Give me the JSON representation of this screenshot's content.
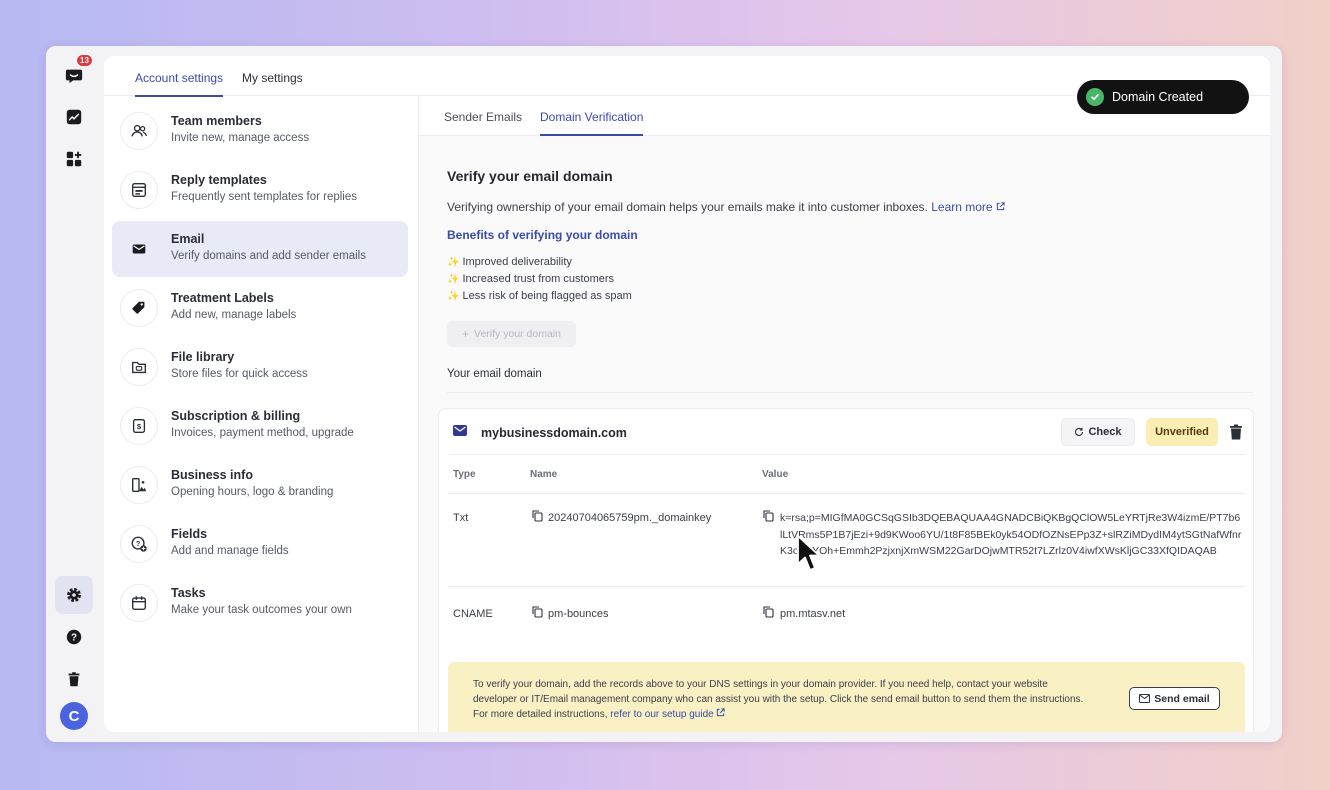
{
  "rail": {
    "notification_count": "13",
    "items": [
      {
        "icon": "chat-logo-icon"
      },
      {
        "icon": "chart-icon"
      },
      {
        "icon": "apps-icon"
      },
      {
        "icon": "gear-icon"
      },
      {
        "icon": "help-icon"
      },
      {
        "icon": "trash-icon"
      }
    ],
    "avatar_initial": "C"
  },
  "settings_tabs": [
    {
      "label": "Account settings",
      "active": true
    },
    {
      "label": "My settings",
      "active": false
    }
  ],
  "sidebar": {
    "items": [
      {
        "title": "Team members",
        "subtitle": "Invite new, manage access",
        "icon": "users-icon"
      },
      {
        "title": "Reply templates",
        "subtitle": "Frequently sent templates for replies",
        "icon": "template-icon"
      },
      {
        "title": "Email",
        "subtitle": "Verify domains and add sender emails",
        "icon": "mail-icon",
        "active": true
      },
      {
        "title": "Treatment Labels",
        "subtitle": "Add new, manage labels",
        "icon": "tag-icon"
      },
      {
        "title": "File library",
        "subtitle": "Store files for quick access",
        "icon": "folder-icon"
      },
      {
        "title": "Subscription & billing",
        "subtitle": "Invoices, payment method, upgrade",
        "icon": "billing-icon"
      },
      {
        "title": "Business info",
        "subtitle": "Opening hours, logo & branding",
        "icon": "business-icon"
      },
      {
        "title": "Fields",
        "subtitle": "Add and manage fields",
        "icon": "fields-icon"
      },
      {
        "title": "Tasks",
        "subtitle": "Make your task outcomes your own",
        "icon": "calendar-icon"
      }
    ]
  },
  "main_tabs": [
    {
      "label": "Sender Emails",
      "active": false
    },
    {
      "label": "Domain Verification",
      "active": true
    }
  ],
  "verify": {
    "heading": "Verify your email domain",
    "description": "Verifying ownership of your email domain helps your emails make it into customer inboxes.",
    "learn_more": "Learn more",
    "benefits_title": "Benefits of verifying your domain",
    "benefits": [
      "Improved deliverability",
      "Increased trust from customers",
      "Less risk of being flagged as spam"
    ],
    "verify_button": "Verify your domain",
    "your_domain_label": "Your email domain"
  },
  "domain_card": {
    "domain": "mybusinessdomain.com",
    "check_label": "Check",
    "status": "Unverified",
    "columns": [
      "Type",
      "Name",
      "Value"
    ],
    "records": [
      {
        "type": "Txt",
        "name": "20240704065759pm._domainkey",
        "value": "k=rsa;p=MIGfMA0GCSqGSIb3DQEBAQUAA4GNADCBiQKBgQClOW5LeYRTjRe3W4izmE/PT7b6lLtVRms5P1B7jEzi+9d9KWoo6YU/1t8F85BEk0yk54ODfOZNsEPp3Z+slRZiMDydIM4ytSGtNafWfnrK3o7NYOh+Emmh2PzjxnjXmWSM22GarDOjwMTR52t7LZrlz0V4iwfXWsKljGC33XfQIDAQAB"
      },
      {
        "type": "CNAME",
        "name": "pm-bounces",
        "value": "pm.mtasv.net"
      }
    ],
    "notice_text": "To verify your domain, add the records above to your DNS settings in your domain provider. If you need help, contact your website developer or IT/Email management company who can assist you with the setup. Click the send email button to send them the instructions. For more detailed instructions,",
    "notice_link": "refer to our setup guide",
    "send_email_label": "Send email"
  },
  "toast": {
    "message": "Domain Created"
  }
}
